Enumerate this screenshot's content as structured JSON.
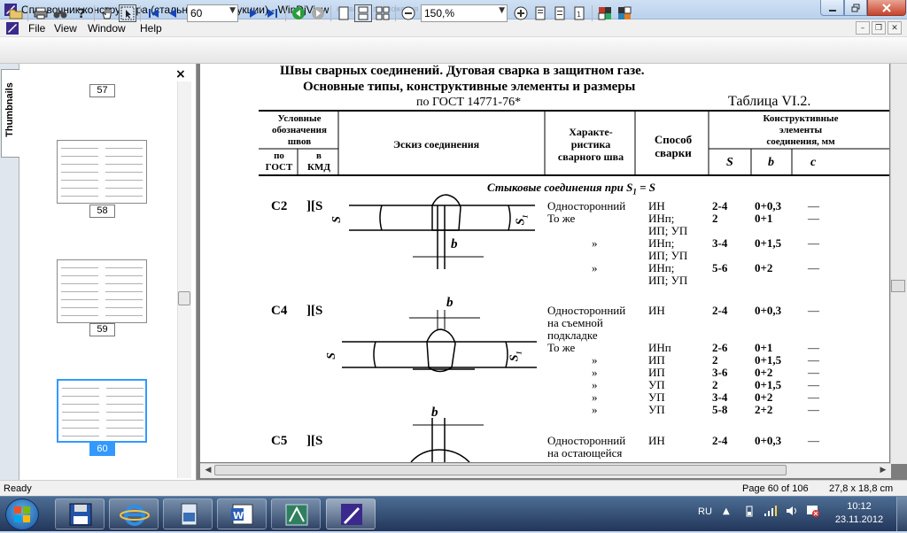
{
  "window": {
    "title": "Справочник конструктора (стальные конструкции) - WinDjView",
    "ghost_title": "название приложения 2 - Microsoft Word"
  },
  "menu": [
    "File",
    "View",
    "Window",
    "Help"
  ],
  "toolbar": {
    "page_value": "60",
    "zoom_value": "150,%"
  },
  "thumbnails": {
    "tab_label": "Thumbnails",
    "close_label": "×",
    "pages": [
      "57",
      "58",
      "59",
      "60"
    ],
    "selected": "60"
  },
  "document": {
    "heading1": "Швы сварных соединений. Дуговая сварка в защитном газе.",
    "heading2": "Основные типы, конструктивные элементы и размеры",
    "heading3": "по  ГОСТ  14771-76*",
    "table_label": "Таблица  VI.2.",
    "columns": {
      "cond_designation": [
        "Условные",
        "обозначения",
        "швов"
      ],
      "gost": [
        "по",
        "ГОСТ"
      ],
      "kmd": [
        "в",
        "КМД"
      ],
      "sketch": "Эскиз соединения",
      "characteristic": [
        "Характе-",
        "ристика",
        "сварного шва"
      ],
      "method": [
        "Способ",
        "сварки"
      ],
      "elements": [
        "Конструктивные",
        "элементы",
        "соединения, мм"
      ],
      "s": "S",
      "b": "b",
      "c": "c"
    },
    "section": "Стыковые соединения при S",
    "section_sub": "1",
    "section_tail": " = S",
    "sketch_labels": {
      "s": "S",
      "s1": "S",
      "sub1": "1",
      "b": "b"
    },
    "rows": [
      {
        "gost": "С2",
        "kmd": "][S",
        "char": "Односторонний",
        "method": "ИН",
        "s": "2-4",
        "b": "0+0,3",
        "c": "—"
      },
      {
        "char": "То же",
        "method": "ИНп;",
        "s": "2",
        "b": "0+1",
        "c": "—"
      },
      {
        "method": "ИП; УП"
      },
      {
        "mark": "»",
        "method": "ИНп;",
        "s": "3-4",
        "b": "0+1,5",
        "c": "—"
      },
      {
        "method": "ИП; УП"
      },
      {
        "mark": "»",
        "method": "ИНп;",
        "s": "5-6",
        "b": "0+2",
        "c": "—"
      },
      {
        "method": "ИП; УП"
      },
      {
        "gost": "С4",
        "kmd": "][S",
        "char": "Односторонний",
        "method": "ИН",
        "s": "2-4",
        "b": "0+0,3",
        "c": "—"
      },
      {
        "char": "на съемной"
      },
      {
        "char": "подкладке"
      },
      {
        "char": "То же",
        "method": "ИНп",
        "s": "2-6",
        "b": "0+1",
        "c": "—"
      },
      {
        "mark": "»",
        "method": "ИП",
        "s": "2",
        "b": "0+1,5",
        "c": "—"
      },
      {
        "mark": "»",
        "method": "ИП",
        "s": "3-6",
        "b": "0+2",
        "c": "—"
      },
      {
        "mark": "»",
        "method": "УП",
        "s": "2",
        "b": "0+1,5",
        "c": "—"
      },
      {
        "mark": "»",
        "method": "УП",
        "s": "3-4",
        "b": "0+2",
        "c": "—"
      },
      {
        "mark": "»",
        "method": "УП",
        "s": "5-8",
        "b": "2+2",
        "c": "—"
      },
      {
        "gost": "С5",
        "kmd": "][S",
        "char": "Односторонний",
        "method": "ИН",
        "s": "2-4",
        "b": "0+0,3",
        "c": "—"
      },
      {
        "char": "на остающейся"
      }
    ]
  },
  "status": {
    "left": "Ready",
    "page_info": "Page 60 of 106",
    "size": "27,8 x 18,8 cm"
  },
  "tray": {
    "lang": "RU",
    "time": "10:12",
    "date": "23.11.2012"
  },
  "colors": {
    "selection": "#3399ff",
    "taskbar": "#22365a"
  }
}
